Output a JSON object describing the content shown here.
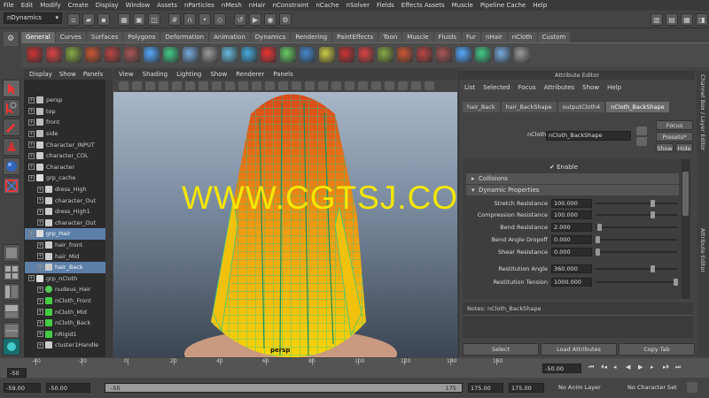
{
  "menubar": [
    "File",
    "Edit",
    "Modify",
    "Create",
    "Display",
    "Window",
    "Assets",
    "nParticles",
    "nMesh",
    "nHair",
    "nConstraint",
    "nCache",
    "nSolver",
    "Fields",
    "Effects Assets",
    "Muscle",
    "Pipeline Cache",
    "Help"
  ],
  "menuset": "nDynamics",
  "shelf_tabs": [
    "General",
    "Curves",
    "Surfaces",
    "Polygons",
    "Deformation",
    "Animation",
    "Dynamics",
    "Rendering",
    "PaintEffects",
    "Toon",
    "Muscle",
    "Fluids",
    "Fur",
    "nHair",
    "nCloth",
    "Custom"
  ],
  "shelf_active": "General",
  "outliner": {
    "menu": [
      "Display",
      "Show",
      "Panels"
    ],
    "items": [
      {
        "label": "persp",
        "indent": 0,
        "icon": "camera"
      },
      {
        "label": "top",
        "indent": 0,
        "icon": "camera"
      },
      {
        "label": "front",
        "indent": 0,
        "icon": "camera"
      },
      {
        "label": "side",
        "indent": 0,
        "icon": "camera"
      },
      {
        "label": "Character_INPUT",
        "indent": 0,
        "icon": "mesh"
      },
      {
        "label": "character_COL",
        "indent": 0,
        "icon": "mesh"
      },
      {
        "label": "Character",
        "indent": 0,
        "icon": "mesh"
      },
      {
        "label": "grp_cache",
        "indent": 0,
        "icon": "group"
      },
      {
        "label": "dress_High",
        "indent": 1,
        "icon": "mesh"
      },
      {
        "label": "character_Out",
        "indent": 1,
        "icon": "mesh"
      },
      {
        "label": "dress_High1",
        "indent": 1,
        "icon": "mesh"
      },
      {
        "label": "character_Out",
        "indent": 1,
        "icon": "mesh"
      },
      {
        "label": "grp_Hair",
        "indent": 0,
        "icon": "group",
        "selected": true
      },
      {
        "label": "hair_front",
        "indent": 1,
        "icon": "mesh"
      },
      {
        "label": "hair_Mid",
        "indent": 1,
        "icon": "mesh"
      },
      {
        "label": "hair_Back",
        "indent": 1,
        "icon": "mesh",
        "selected": true
      },
      {
        "label": "grp_nCloth",
        "indent": 0,
        "icon": "group"
      },
      {
        "label": "nudeus_Hair",
        "indent": 1,
        "icon": "nucleus"
      },
      {
        "label": "nCloth_Front",
        "indent": 1,
        "icon": "ncloth"
      },
      {
        "label": "nCloth_Mid",
        "indent": 1,
        "icon": "ncloth"
      },
      {
        "label": "nCloth_Back",
        "indent": 1,
        "icon": "ncloth"
      },
      {
        "label": "nRigid1",
        "indent": 1,
        "icon": "ncloth"
      },
      {
        "label": "cluster1Handle",
        "indent": 1,
        "icon": "mesh"
      }
    ]
  },
  "viewport": {
    "menu": [
      "View",
      "Shading",
      "Lighting",
      "Show",
      "Renderer",
      "Panels"
    ],
    "camera_label": "persp",
    "watermark": "WWW.CGTSJ.COM"
  },
  "attribute_editor": {
    "title": "Attribute Editor",
    "menu": [
      "List",
      "Selected",
      "Focus",
      "Attributes",
      "Show",
      "Help"
    ],
    "tabs": [
      "hair_Back",
      "hair_BackShape",
      "outputCloth4",
      "nCloth_BackShape"
    ],
    "active_tab": "nCloth_BackShape",
    "node_label": "nCloth:",
    "node_value": "nCloth_BackShape",
    "focus": "Focus",
    "presets": "Presets*",
    "show": "Show",
    "hide": "Hide",
    "enable": "Enable",
    "sections": [
      "Collisions",
      "Dynamic Properties"
    ],
    "attrs": [
      {
        "label": "Stretch Resistance",
        "value": "100.000",
        "fill": 0.7
      },
      {
        "label": "Compression Resistance",
        "value": "100.000",
        "fill": 0.7
      },
      {
        "label": "Bend Resistance",
        "value": "2.000",
        "fill": 0.02
      },
      {
        "label": "Bend Angle Dropoff",
        "value": "0.000",
        "fill": 0.0
      },
      {
        "label": "Shear Resistance",
        "value": "0.000",
        "fill": 0.0
      },
      {
        "label": "Restitution Angle",
        "value": "360.000",
        "fill": 0.7
      },
      {
        "label": "Restitution Tension",
        "value": "1000.000",
        "fill": 1.0
      }
    ],
    "notes_label": "Notes: nCloth_BackShape",
    "bottom_buttons": [
      "Select",
      "Load Attributes",
      "Copy Tab"
    ]
  },
  "right_strip": "Channel Box / Layer Editor",
  "right_strip2": "Attribute Editor",
  "timeline": {
    "ticks": [
      "-40",
      "-20",
      "0",
      "20",
      "40",
      "60",
      "80",
      "100",
      "120",
      "140",
      "160"
    ],
    "current": "-50.00"
  },
  "range": {
    "start": "-59.00",
    "min": "-50.00",
    "slider_start": "-50",
    "slider_end": "175",
    "max": "175.00",
    "end": "175.00",
    "anim_layer": "No Anim Layer",
    "char_set": "No Character Set"
  }
}
